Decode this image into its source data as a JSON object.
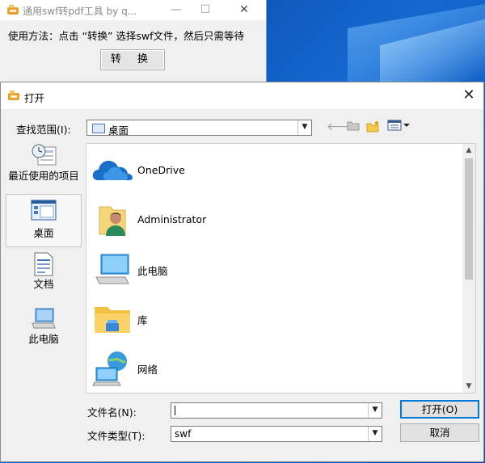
{
  "back_window": {
    "title": "通用swf转pdf工具 by q...",
    "instruction": "使用方法：点击 “转换” 选择swf文件，然后只需等待",
    "convert_button": "转 换",
    "minimize_glyph": "—",
    "maximize_glyph": "☐",
    "close_glyph": "✕"
  },
  "dialog": {
    "title": "打开",
    "close_glyph": "✕",
    "look_in_label": "查找范围(I):",
    "look_in_value": "桌面",
    "places": [
      {
        "label": "最近使用的项目",
        "icon": "recent-icon"
      },
      {
        "label": "桌面",
        "icon": "desktop-icon"
      },
      {
        "label": "文档",
        "icon": "documents-icon"
      },
      {
        "label": "此电脑",
        "icon": "this-pc-icon"
      }
    ],
    "items": [
      {
        "name": "OneDrive",
        "icon": "onedrive-icon"
      },
      {
        "name": "Administrator",
        "icon": "user-folder-icon"
      },
      {
        "name": "此电脑",
        "icon": "computer-icon"
      },
      {
        "name": "库",
        "icon": "library-folder-icon"
      },
      {
        "name": "网络",
        "icon": "network-icon"
      }
    ],
    "file_name_label": "文件名(N):",
    "file_name_value": "",
    "file_type_label": "文件类型(T):",
    "file_type_value": "swf",
    "open_button": "打开(O)",
    "cancel_button": "取消"
  },
  "colors": {
    "accent": "#0078d7",
    "desktop": "#1468d0"
  }
}
